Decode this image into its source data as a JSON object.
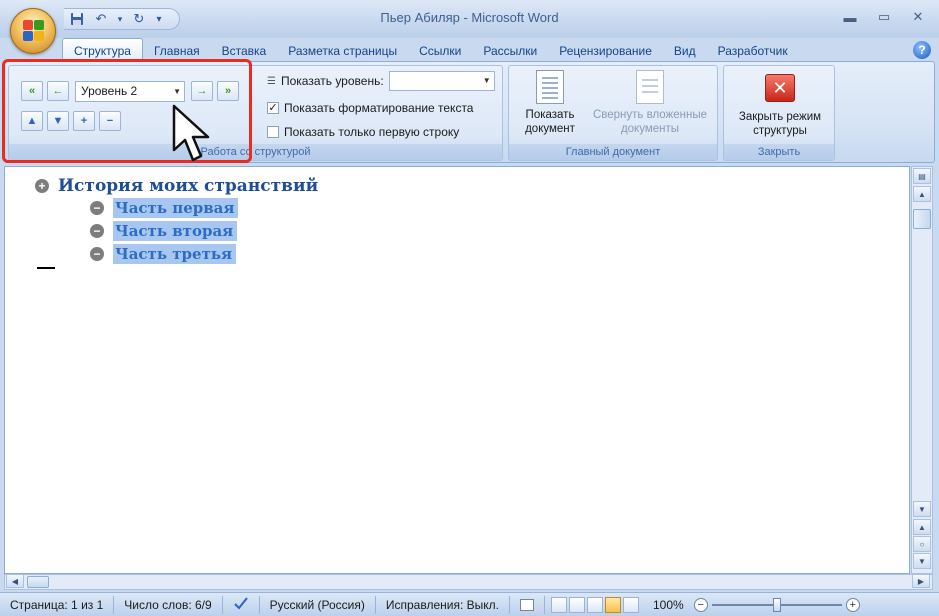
{
  "window": {
    "title": "Пьер Абиляр - Microsoft Word",
    "minimize_glyph": "▬",
    "maximize_glyph": "▭",
    "close_glyph": "✕"
  },
  "quick_access": {
    "save_icon": "floppy",
    "undo_glyph": "↶",
    "undo_dropdown_glyph": "▾",
    "redo_glyph": "↻",
    "customize_glyph": "▾"
  },
  "tabs": [
    {
      "label": "Структура",
      "active": true
    },
    {
      "label": "Главная"
    },
    {
      "label": "Вставка"
    },
    {
      "label": "Разметка страницы"
    },
    {
      "label": "Ссылки"
    },
    {
      "label": "Рассылки"
    },
    {
      "label": "Рецензирование"
    },
    {
      "label": "Вид"
    },
    {
      "label": "Разработчик"
    }
  ],
  "help_glyph": "?",
  "ribbon": {
    "outline_group": {
      "label": "Работа со структурой",
      "promote_to_heading_glyph": "«",
      "promote_glyph": "←",
      "level_value": "Уровень 2",
      "demote_glyph": "→",
      "demote_to_body_glyph": "»",
      "move_up_glyph": "▲",
      "move_down_glyph": "▼",
      "expand_glyph": "+",
      "collapse_glyph": "−",
      "show_level_label": "Показать уровень:",
      "show_formatting_label": "Показать форматирование текста",
      "show_formatting_checked": true,
      "check_glyph": "✓",
      "show_first_line_label": "Показать только первую строку",
      "show_first_line_checked": false
    },
    "master_group": {
      "label": "Главный документ",
      "show_document_line1": "Показать",
      "show_document_line2": "документ",
      "collapse_subdocs_line1": "Свернуть вложенные",
      "collapse_subdocs_line2": "документы"
    },
    "close_group": {
      "label": "Закрыть",
      "close_outline_line1": "Закрыть режим",
      "close_outline_line2": "структуры",
      "close_glyph": "✕"
    }
  },
  "document": {
    "heading1": {
      "text": "История моих странствий",
      "bullet": "+"
    },
    "headings2": [
      {
        "text": "Часть первая",
        "bullet": "−"
      },
      {
        "text": "Часть вторая",
        "bullet": "−"
      },
      {
        "text": "Часть третья",
        "bullet": "−"
      }
    ]
  },
  "scrollbars": {
    "up_glyph": "▲",
    "down_glyph": "▼",
    "prev_page_glyph": "▲",
    "browse_glyph": "○",
    "next_page_glyph": "▼",
    "left_glyph": "◀",
    "right_glyph": "▶"
  },
  "statusbar": {
    "page": "Страница: 1 из 1",
    "words": "Число слов: 6/9",
    "language": "Русский (Россия)",
    "track_changes": "Исправления: Выкл.",
    "zoom": "100%",
    "zoom_out_glyph": "−",
    "zoom_in_glyph": "+"
  },
  "colors": {
    "accent_blue": "#15428b",
    "highlight_red": "#ea2b20",
    "heading1": "#1f4e97",
    "heading2": "#2e6cc4",
    "selection": "#a8c7f0"
  }
}
